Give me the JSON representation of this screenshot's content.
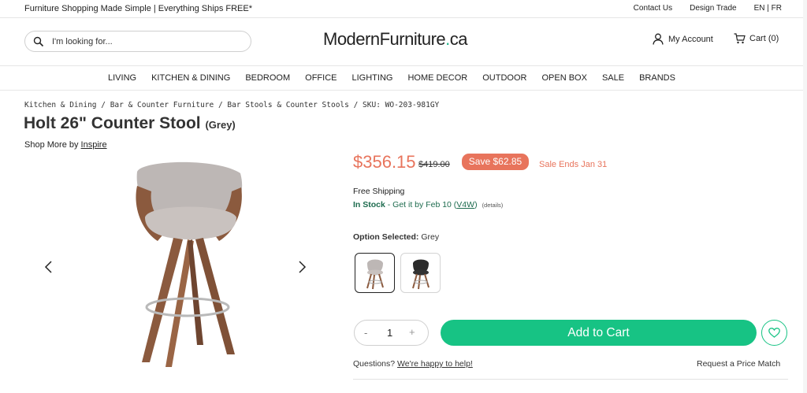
{
  "topbar": {
    "promo": "Furniture Shopping Made Simple | Everything Ships FREE*",
    "contact": "Contact Us",
    "design_trade": "Design Trade",
    "lang": "EN | FR"
  },
  "header": {
    "search_placeholder": "I'm looking for...",
    "logo_main": "ModernFurniture",
    "logo_dot": ".",
    "logo_tld": "ca",
    "account": "My Account",
    "cart": "Cart (0)"
  },
  "nav": {
    "items": [
      "LIVING",
      "KITCHEN & DINING",
      "BEDROOM",
      "OFFICE",
      "LIGHTING",
      "HOME DECOR",
      "OUTDOOR",
      "OPEN BOX",
      "SALE",
      "BRANDS"
    ]
  },
  "breadcrumb": {
    "items": [
      "Kitchen & Dining",
      "Bar & Counter Furniture",
      "Bar Stools & Counter Stools"
    ],
    "separator": " / ",
    "sku": "SKU: WO-203-981GY"
  },
  "product": {
    "title": "Holt 26\" Counter Stool",
    "variant": "(Grey)",
    "shop_more_prefix": "Shop More by ",
    "brand": "Inspire",
    "price": "$356.15",
    "old_price": "$419.00",
    "save_badge": "Save $62.85",
    "sale_ends": "Sale Ends Jan 31",
    "shipping": "Free Shipping",
    "stock_status": "In Stock",
    "delivery_text": " - Get it by Feb 10 (",
    "postal_code": "V4W",
    "delivery_close": ")",
    "details_link": "(details)",
    "option_label": "Option Selected:",
    "option_value": " Grey",
    "quantity": "1",
    "qty_minus": "-",
    "qty_plus": "+",
    "add_to_cart": "Add to Cart",
    "questions_prefix": "Questions? ",
    "help_link": "We're happy to help!",
    "price_match": "Request a Price Match"
  },
  "colors": {
    "accent_green": "#17c384",
    "sale_orange": "#e8745c",
    "stock_green": "#1d6b4e"
  }
}
